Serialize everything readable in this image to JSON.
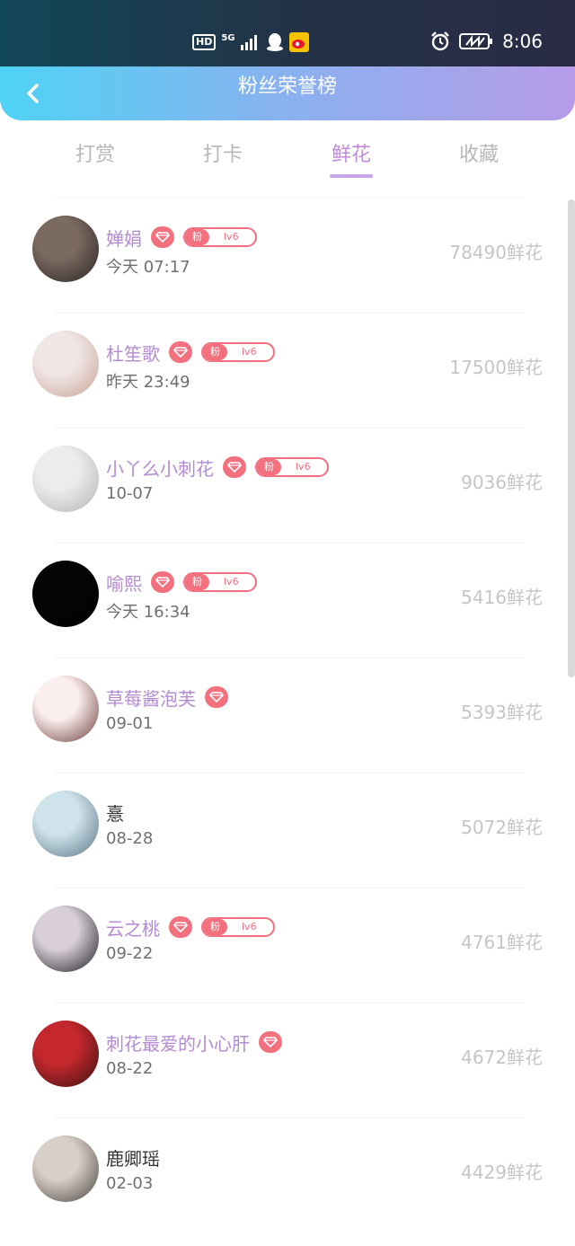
{
  "status_bar": {
    "hd": "HD",
    "network": "5G",
    "time": "8:06"
  },
  "header": {
    "title": "粉丝荣誉榜"
  },
  "tabs": [
    "打赏",
    "打卡",
    "鲜花",
    "收藏"
  ],
  "active_tab_index": 2,
  "badge": {
    "fan": "粉",
    "level": "lv6"
  },
  "rows": [
    {
      "name": "婵娟",
      "time": "今天 07:17",
      "count": "78490鲜花",
      "vip": true,
      "fan_badge": true,
      "colors": [
        "#7a6a60",
        "#2a2424"
      ]
    },
    {
      "name": "杜笙歌",
      "time": "昨天 23:49",
      "count": "17500鲜花",
      "vip": true,
      "fan_badge": true,
      "colors": [
        "#f0e6e6",
        "#c8a494"
      ]
    },
    {
      "name": "小丫么小刺花",
      "time": "10-07",
      "count": "9036鲜花",
      "vip": true,
      "fan_badge": true,
      "colors": [
        "#ececec",
        "#b0b4b8"
      ]
    },
    {
      "name": "喻熙",
      "time": "今天 16:34",
      "count": "5416鲜花",
      "vip": true,
      "fan_badge": true,
      "colors": [
        "#050505",
        "#000000"
      ]
    },
    {
      "name": "草莓酱泡芙",
      "time": "09-01",
      "count": "5393鲜花",
      "vip": true,
      "fan_badge": false,
      "colors": [
        "#fbeeee",
        "#6a3e3a"
      ]
    },
    {
      "name": "憙",
      "time": "08-28",
      "count": "5072鲜花",
      "vip": false,
      "fan_badge": false,
      "colors": [
        "#cfe4ea",
        "#5b7486"
      ]
    },
    {
      "name": "云之桃",
      "time": "09-22",
      "count": "4761鲜花",
      "vip": true,
      "fan_badge": true,
      "colors": [
        "#d8cfd8",
        "#1e1a22"
      ]
    },
    {
      "name": "刺花最爱的小心肝",
      "time": "08-22",
      "count": "4672鲜花",
      "vip": true,
      "fan_badge": false,
      "colors": [
        "#c4282e",
        "#3a1210"
      ]
    },
    {
      "name": "鹿卿瑶",
      "time": "02-03",
      "count": "4429鲜花",
      "vip": false,
      "fan_badge": false,
      "colors": [
        "#d8d0c8",
        "#4a4440"
      ]
    }
  ]
}
